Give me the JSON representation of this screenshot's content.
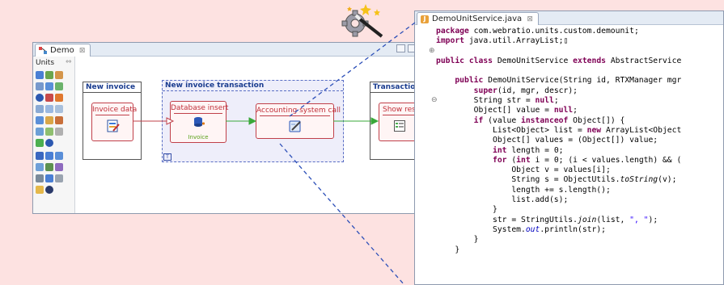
{
  "demo_window": {
    "tab_label": "Demo",
    "tab_close": "⊠",
    "palette_title": "Units",
    "palette_toggle": "⇔"
  },
  "diagram": {
    "pools": [
      {
        "title": "New invoice"
      },
      {
        "title": "New invoice transaction"
      },
      {
        "title": "Transaction re"
      }
    ],
    "units": [
      {
        "label": "Invoice data",
        "icon": "form-edit-icon"
      },
      {
        "label": "Database insert",
        "sublabel": "Invoice",
        "icon": "database-insert-icon"
      },
      {
        "label": "Accounting system call",
        "icon": "script-edit-icon"
      },
      {
        "label": "Show resul",
        "icon": "list-view-icon"
      }
    ],
    "transaction_marker": "T"
  },
  "code_window": {
    "tab_label": "DemoUnitService.java",
    "tab_close": "⊠",
    "tab_icon_letter": "J",
    "fold_markers": [
      "⊕",
      "⊖"
    ]
  },
  "overlay": {
    "icon": "magic-wand-gear-icon"
  },
  "colors": {
    "background": "#fde2e1",
    "unit_border": "#c0404a",
    "flow_green": "#3aa83a",
    "transaction_blue": "#5a6ec4",
    "keyword": "#7f0055",
    "string": "#2a00ff"
  }
}
